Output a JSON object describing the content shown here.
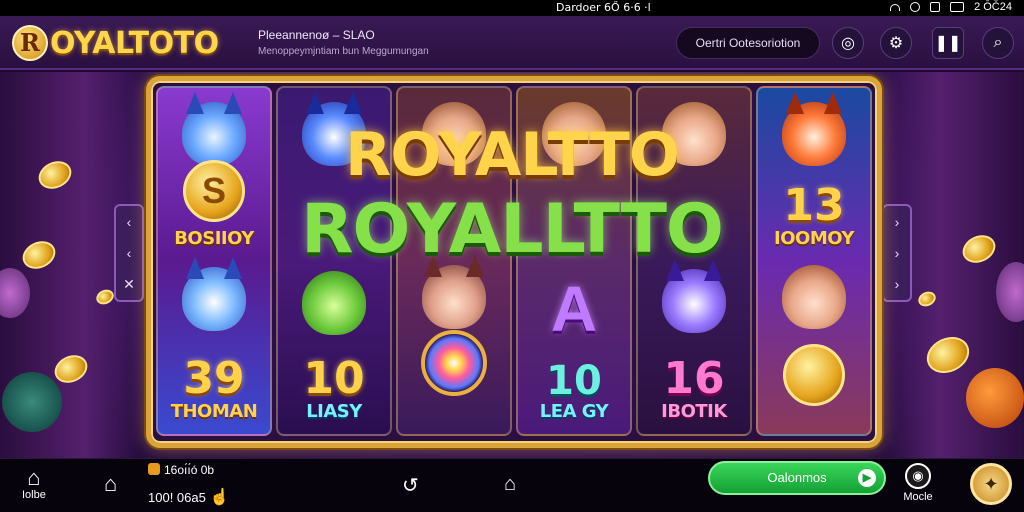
{
  "status_bar": {
    "time": "Dardoer 6Ő 6·6 ·l",
    "right_text": "2 ŌČ24"
  },
  "header": {
    "logo_letter": "R",
    "logo_text": "OYALTOTO",
    "subtitle": "Pleeannenoø – SLAO",
    "caption": "Menoppeymjntiam bun Meggumungan",
    "pill_label": "Oertri Ootesoriotion",
    "icons": [
      "target-icon",
      "settings-icon",
      "pause-icon",
      "search-icon"
    ]
  },
  "game": {
    "title_line1": "ROYALTTO",
    "title_line2": "ROYALLTTO",
    "reels": [
      {
        "top": {
          "type": "coin",
          "symbol": "S",
          "label": "BOSIIOY"
        },
        "bottom": {
          "type": "number",
          "value": "39",
          "label": "THOMAN"
        }
      },
      {
        "top": {
          "type": "face",
          "symbol": "",
          "label": ""
        },
        "bottom": {
          "type": "number",
          "value": "10",
          "label": "LIASY"
        }
      },
      {
        "top": {
          "type": "face",
          "symbol": "",
          "label": ""
        },
        "bottom": {
          "type": "gem",
          "value": "",
          "label": ""
        }
      },
      {
        "top": {
          "type": "face",
          "symbol": "",
          "label": ""
        },
        "bottom": {
          "type": "letter",
          "value": "A",
          "label": "10"
        }
      },
      {
        "top": {
          "type": "face",
          "symbol": "",
          "label": ""
        },
        "bottom": {
          "type": "number",
          "value": "16",
          "label": "IBOTIK"
        }
      },
      {
        "top": {
          "type": "number",
          "symbol": "13",
          "label": "IOOMOY"
        },
        "bottom": {
          "type": "coin-face",
          "value": "",
          "label": ""
        }
      }
    ],
    "reel5_label": "LEA GY",
    "left_arrows": [
      "‹",
      "‹",
      "✕"
    ],
    "right_arrows": [
      "›",
      "›",
      "›"
    ]
  },
  "bottom_bar": {
    "home_label": "Iolbe",
    "balance_top": "16oı́ı́ó    0b",
    "balance_bottom": "100! 06a5",
    "green_button": "Oalonmos",
    "profile_label": "Mocle"
  },
  "colors": {
    "accent_gold": "#ffd44a",
    "accent_green": "#86e04a",
    "frame_gold": "#d9a53a",
    "background": "#1a0b2e"
  }
}
